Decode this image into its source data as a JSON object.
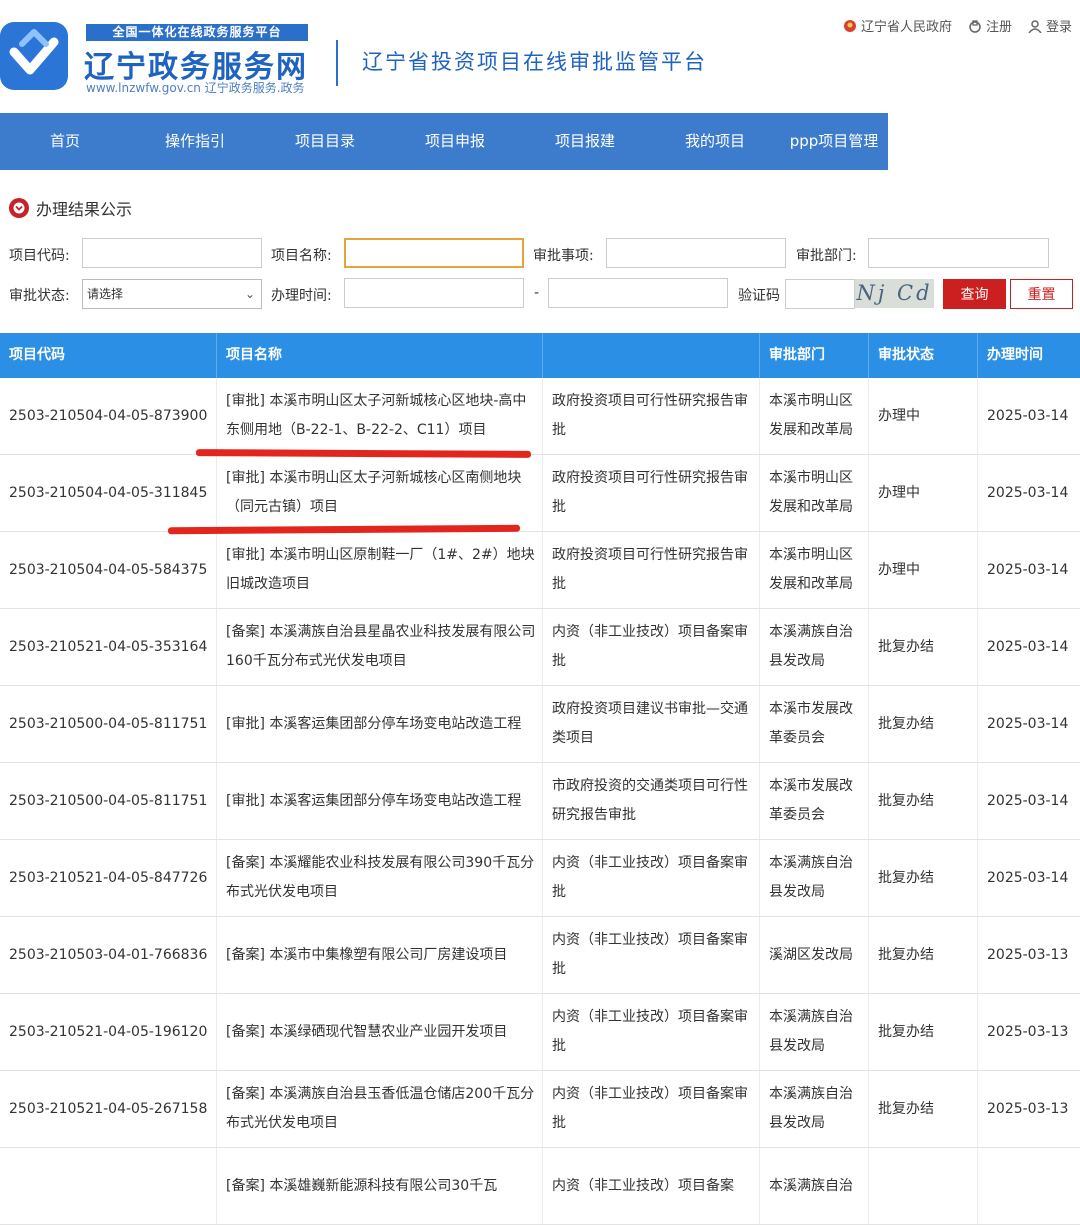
{
  "header": {
    "brand_top": "全国一体化在线政务服务平台",
    "brand_main": "辽宁政务服务网",
    "brand_url": "www.lnzwfw.gov.cn  辽宁政务服务.政务",
    "platform_title": "辽宁省投资项目在线审批监管平台",
    "top_links": {
      "gov": "辽宁省人民政府",
      "register": "注册",
      "login": "登录"
    },
    "brand_color": "#1f63c0"
  },
  "nav": {
    "items": [
      "首页",
      "操作指引",
      "项目目录",
      "项目申报",
      "项目报建",
      "我的项目",
      "ppp项目管理"
    ],
    "color": "#3d7ccc"
  },
  "section": {
    "title": "办理结果公示"
  },
  "filters": {
    "project_code_label": "项目代码:",
    "project_name_label": "项目名称:",
    "approval_item_label": "审批事项:",
    "approval_dept_label": "审批部门:",
    "approval_status_label": "审批状态:",
    "status_selected": "请选择",
    "process_time_label": "办理时间:",
    "time_separator": "-",
    "captcha_label": "验证码",
    "captcha_text": "Nj Cd",
    "query_button": "查询",
    "reset_button": "重置"
  },
  "table": {
    "columns": [
      "项目代码",
      "项目名称",
      "",
      "审批部门",
      "审批状态",
      "办理时间"
    ],
    "header_color": "#2b8fe6",
    "rows": [
      {
        "code": "2503-210504-04-05-873900",
        "name": "[审批] 本溪市明山区太子河新城核心区地块-高中东侧用地（B-22-1、B-22-2、C11）项目",
        "item": "政府投资项目可行性研究报告审批",
        "dept": "本溪市明山区发展和改革局",
        "status": "办理中",
        "date": "2025-03-14"
      },
      {
        "code": "2503-210504-04-05-311845",
        "name": "[审批] 本溪市明山区太子河新城核心区南侧地块（同元古镇）项目",
        "item": "政府投资项目可行性研究报告审批",
        "dept": "本溪市明山区发展和改革局",
        "status": "办理中",
        "date": "2025-03-14"
      },
      {
        "code": "2503-210504-04-05-584375",
        "name": "[审批] 本溪市明山区原制鞋一厂（1#、2#）地块旧城改造项目",
        "item": "政府投资项目可行性研究报告审批",
        "dept": "本溪市明山区发展和改革局",
        "status": "办理中",
        "date": "2025-03-14"
      },
      {
        "code": "2503-210521-04-05-353164",
        "name": "[备案] 本溪满族自治县星晶农业科技发展有限公司160千瓦分布式光伏发电项目",
        "item": "内资（非工业技改）项目备案审批",
        "dept": "本溪满族自治县发改局",
        "status": "批复办结",
        "date": "2025-03-14"
      },
      {
        "code": "2503-210500-04-05-811751",
        "name": "[审批] 本溪客运集团部分停车场变电站改造工程",
        "item": "政府投资项目建议书审批—交通类项目",
        "dept": "本溪市发展改革委员会",
        "status": "批复办结",
        "date": "2025-03-14"
      },
      {
        "code": "2503-210500-04-05-811751",
        "name": "[审批] 本溪客运集团部分停车场变电站改造工程",
        "item": "市政府投资的交通类项目可行性研究报告审批",
        "dept": "本溪市发展改革委员会",
        "status": "批复办结",
        "date": "2025-03-14"
      },
      {
        "code": "2503-210521-04-05-847726",
        "name": "[备案] 本溪耀能农业科技发展有限公司390千瓦分布式光伏发电项目",
        "item": "内资（非工业技改）项目备案审批",
        "dept": "本溪满族自治县发改局",
        "status": "批复办结",
        "date": "2025-03-14"
      },
      {
        "code": "2503-210503-04-01-766836",
        "name": "[备案] 本溪市中集橡塑有限公司厂房建设项目",
        "item": "内资（非工业技改）项目备案审批",
        "dept": "溪湖区发改局",
        "status": "批复办结",
        "date": "2025-03-13"
      },
      {
        "code": "2503-210521-04-05-196120",
        "name": "[备案] 本溪绿硒现代智慧农业产业园开发项目",
        "item": "内资（非工业技改）项目备案审批",
        "dept": "本溪满族自治县发改局",
        "status": "批复办结",
        "date": "2025-03-13"
      },
      {
        "code": "2503-210521-04-05-267158",
        "name": "[备案] 本溪满族自治县玉香低温仓储店200千瓦分布式光伏发电项目",
        "item": "内资（非工业技改）项目备案审批",
        "dept": "本溪满族自治县发改局",
        "status": "批复办结",
        "date": "2025-03-13"
      },
      {
        "code": "",
        "name": "[备案] 本溪雄巍新能源科技有限公司30千瓦",
        "item": "内资（非工业技改）项目备案",
        "dept": "本溪满族自治",
        "status": "",
        "date": ""
      }
    ]
  }
}
